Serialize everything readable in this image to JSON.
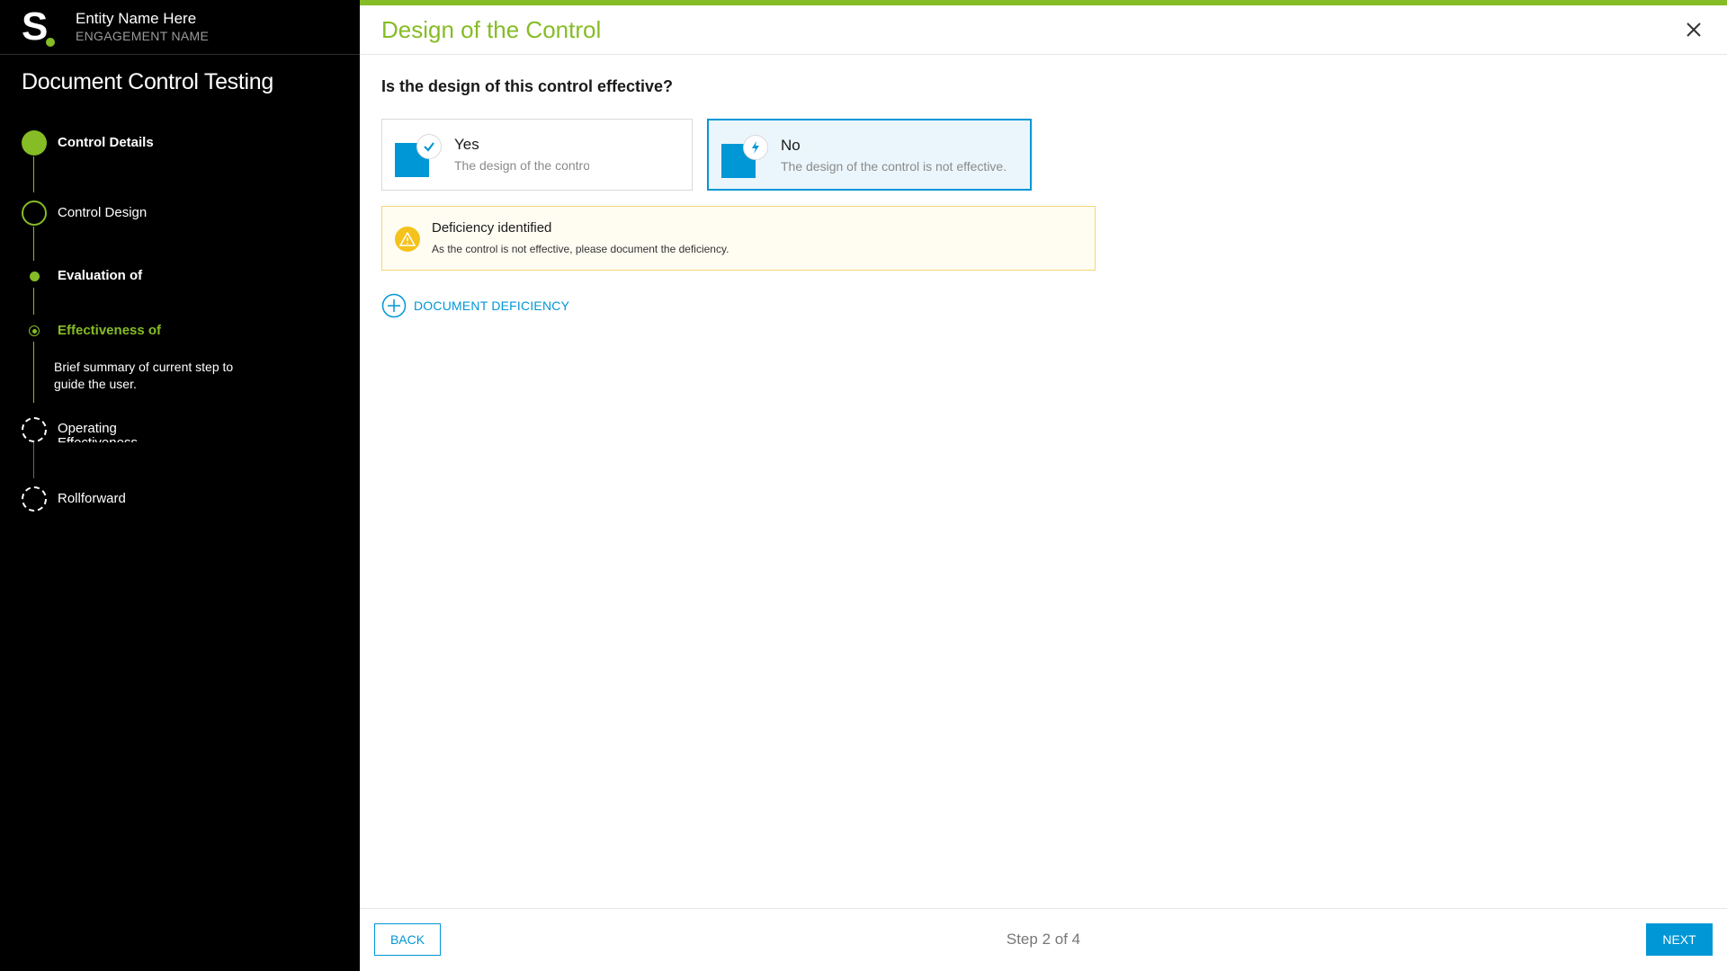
{
  "app": {
    "entity_name": "Entity Name Here",
    "engagement_name": "ENGAGEMENT NAME",
    "flow_title": "Document Control Testing"
  },
  "sidebar": {
    "steps": [
      {
        "label": "Control Details",
        "state": "complete"
      },
      {
        "label": "Control Design",
        "state": "active"
      },
      {
        "label": "Evaluation of",
        "state": "substep-complete"
      },
      {
        "label": "Effectiveness of",
        "state": "substep-current"
      },
      {
        "label": "Operating Effectiveness",
        "state": "pending"
      },
      {
        "label": "Rollforward",
        "state": "pending"
      }
    ],
    "summary": "Brief summary of current step to guide the user."
  },
  "page": {
    "title": "Design of the Control",
    "question": "Is the design of this control effective?",
    "options": [
      {
        "title": "Yes",
        "description": "The design of the control is effective.",
        "selected": false,
        "icon": "check-icon"
      },
      {
        "title": "No",
        "description": "The design of the control is not effective.",
        "selected": true,
        "icon": "lightning-icon"
      }
    ],
    "alert": {
      "title": "Deficiency identified",
      "text": "As the control is not effective, please document the deficiency.",
      "icon": "warning-icon"
    },
    "document_deficiency_label": "DOCUMENT DEFICIENCY"
  },
  "footer": {
    "back_label": "BACK",
    "step_text": "Step 2 of 4",
    "next_label": "NEXT"
  },
  "colors": {
    "accent_green": "#86bc25",
    "accent_blue": "#0097d6",
    "warning": "#f4c21a"
  }
}
